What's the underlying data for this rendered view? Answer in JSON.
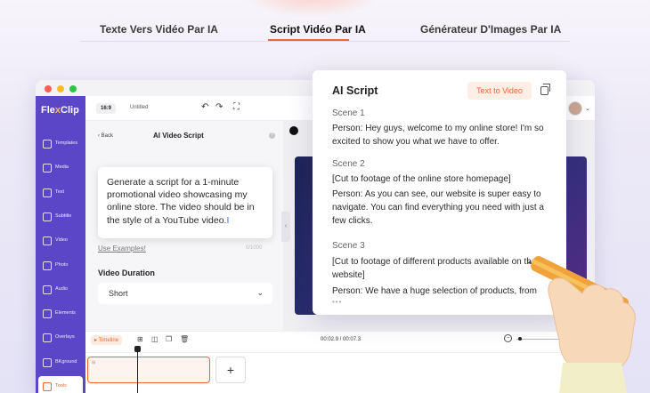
{
  "tabs": [
    {
      "label": "Texte Vers Vidéo Par IA"
    },
    {
      "label": "Script Vidéo Par IA"
    },
    {
      "label": "Générateur D'Images Par IA"
    }
  ],
  "active_tab": "Script Vidéo Par IA",
  "app": {
    "logo": {
      "part1": "Fle",
      "part2": "x",
      "part3": "Clip"
    },
    "aspect_ratio": "16:9",
    "project_name": "Untitled"
  },
  "sidebar": {
    "items": [
      {
        "label": "Templates",
        "icon": "templates-icon"
      },
      {
        "label": "Media",
        "icon": "media-icon"
      },
      {
        "label": "Text",
        "icon": "text-icon"
      },
      {
        "label": "Subtitle",
        "icon": "subtitle-icon"
      },
      {
        "label": "Video",
        "icon": "video-icon"
      },
      {
        "label": "Photo",
        "icon": "photo-icon"
      },
      {
        "label": "Audio",
        "icon": "audio-icon"
      },
      {
        "label": "Elements",
        "icon": "elements-icon"
      },
      {
        "label": "Overlays",
        "icon": "overlays-icon"
      },
      {
        "label": "BKground",
        "icon": "background-icon"
      },
      {
        "label": "Tools",
        "icon": "tools-icon"
      }
    ],
    "active": "Tools"
  },
  "panel": {
    "back_label": "Back",
    "title": "AI Video Script",
    "prompt_text": "Generate a script for a 1-minute promotional video showcasing my online store. The video should be in the style of a YouTube video.",
    "char_count": "0/1000",
    "examples_link": "Use Examples!",
    "duration_label": "Video Duration",
    "duration_value": "Short"
  },
  "timeline": {
    "label": "Timeline",
    "time": "00:02.9 / 00:07.3"
  },
  "ai_script": {
    "title": "AI Script",
    "button_label": "Text to Video",
    "scenes": [
      {
        "heading": "Scene 1",
        "lines": [
          "Person: Hey guys, welcome to my online store! I'm so excited to show you what we have to offer."
        ]
      },
      {
        "heading": "Scene 2",
        "lines": [
          "[Cut to footage of the online store homepage]",
          "Person: As you can see, our website is super easy to navigate. You can find everything you need with just a few clicks."
        ]
      },
      {
        "heading": "Scene 3",
        "lines": [
          "[Cut to footage of different products available on the website]",
          "Person: We have a huge selection of products, from"
        ]
      }
    ],
    "more_indicator": "•••"
  },
  "colors": {
    "accent": "#f0682f",
    "sidebar": "#5a46c6",
    "video_bg": "#1d2457"
  }
}
